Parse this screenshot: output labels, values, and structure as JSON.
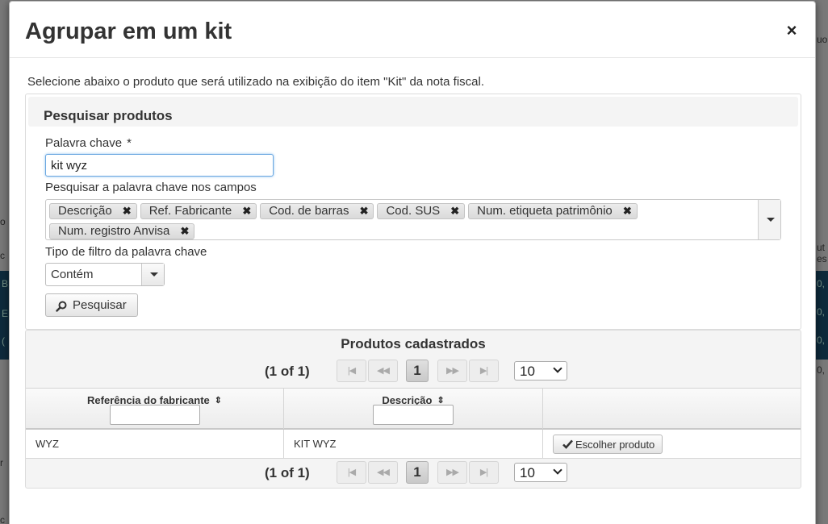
{
  "background": {
    "fragments": [
      "o",
      "c",
      "(",
      "r",
      "E",
      "B",
      "uo",
      "ut",
      "es",
      "0,",
      "0,",
      "0,",
      "0,"
    ]
  },
  "modal": {
    "title": "Agrupar em um kit",
    "close_symbol": "×",
    "intro": "Selecione abaixo o produto que será utilizado na exibição do item \"Kit\" da nota fiscal."
  },
  "search": {
    "panel_title": "Pesquisar produtos",
    "keyword_label": "Palavra chave",
    "required_mark": "*",
    "keyword_value": "kit wyz",
    "fields_label": "Pesquisar a palavra chave nos campos",
    "fields": [
      "Descrição",
      "Ref. Fabricante",
      "Cod. de barras",
      "Cod. SUS",
      "Num. etiqueta patrimônio",
      "Num. registro Anvisa"
    ],
    "chip_remove_symbol": "✖",
    "filter_label": "Tipo de filtro da palavra chave",
    "filter_value": "Contém",
    "button_label": "Pesquisar"
  },
  "results": {
    "title": "Produtos cadastrados",
    "pager": {
      "info": "(1 of 1)",
      "first": "|◀",
      "prev": "◀◀",
      "current_page": "1",
      "next": "▶▶",
      "last": "▶|",
      "page_size": "10"
    },
    "columns": [
      {
        "label": "Referência do fabricante",
        "sort_symbol": "⇕"
      },
      {
        "label": "Descrição",
        "sort_symbol": "⇕"
      },
      {
        "label": ""
      }
    ],
    "rows": [
      {
        "referencia": "WYZ",
        "descricao": "KIT WYZ",
        "action_label": "Escolher produto"
      }
    ]
  },
  "colors": {
    "accent_focus": "#6aa7e0",
    "panel_header_bg": "#f4f4f4",
    "chip_bg": "#dadada",
    "background_band": "#1a4e6e"
  }
}
